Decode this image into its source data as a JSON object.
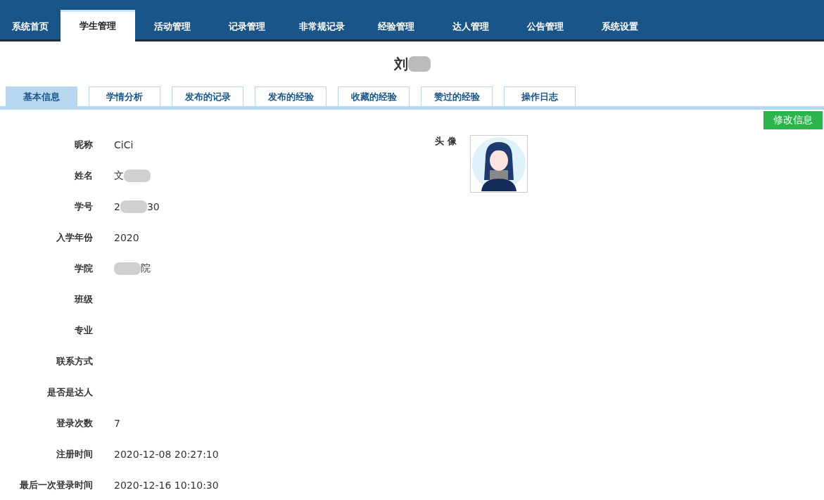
{
  "nav": [
    {
      "label": "系统首页",
      "selected": false
    },
    {
      "label": "学生管理",
      "selected": true
    },
    {
      "label": "活动管理",
      "selected": false
    },
    {
      "label": "记录管理",
      "selected": false
    },
    {
      "label": "非常规记录",
      "selected": false
    },
    {
      "label": "经验管理",
      "selected": false
    },
    {
      "label": "达人管理",
      "selected": false
    },
    {
      "label": "公告管理",
      "selected": false
    },
    {
      "label": "系统设置",
      "selected": false
    }
  ],
  "title": {
    "before": "刘",
    "redacted": true
  },
  "tabs": [
    {
      "label": "基本信息",
      "selected": true
    },
    {
      "label": "学情分析",
      "selected": false
    },
    {
      "label": "发布的记录",
      "selected": false
    },
    {
      "label": "发布的经验",
      "selected": false
    },
    {
      "label": "收藏的经验",
      "selected": false
    },
    {
      "label": "赞过的经验",
      "selected": false
    },
    {
      "label": "操作日志",
      "selected": false
    }
  ],
  "edit_button": "修改信息",
  "fields": [
    {
      "label": "昵称",
      "value": "CiCi"
    },
    {
      "label": "姓名",
      "value": "文",
      "redacted": true
    },
    {
      "label": "学号",
      "value": "2",
      "redacted": true,
      "value_after": "30"
    },
    {
      "label": "入学年份",
      "value": "2020"
    },
    {
      "label": "学院",
      "redacted": true,
      "value_after": "院"
    },
    {
      "label": "班级"
    },
    {
      "label": "专业"
    },
    {
      "label": "联系方式"
    },
    {
      "label": "是否是达人"
    },
    {
      "label": "登录次数",
      "value": "7"
    },
    {
      "label": "注册时间",
      "value": "2020-12-08 20:27:10"
    },
    {
      "label": "最后一次登录时间",
      "value": "2020-12-16 10:10:30"
    }
  ],
  "avatar": {
    "label": "头 像"
  }
}
